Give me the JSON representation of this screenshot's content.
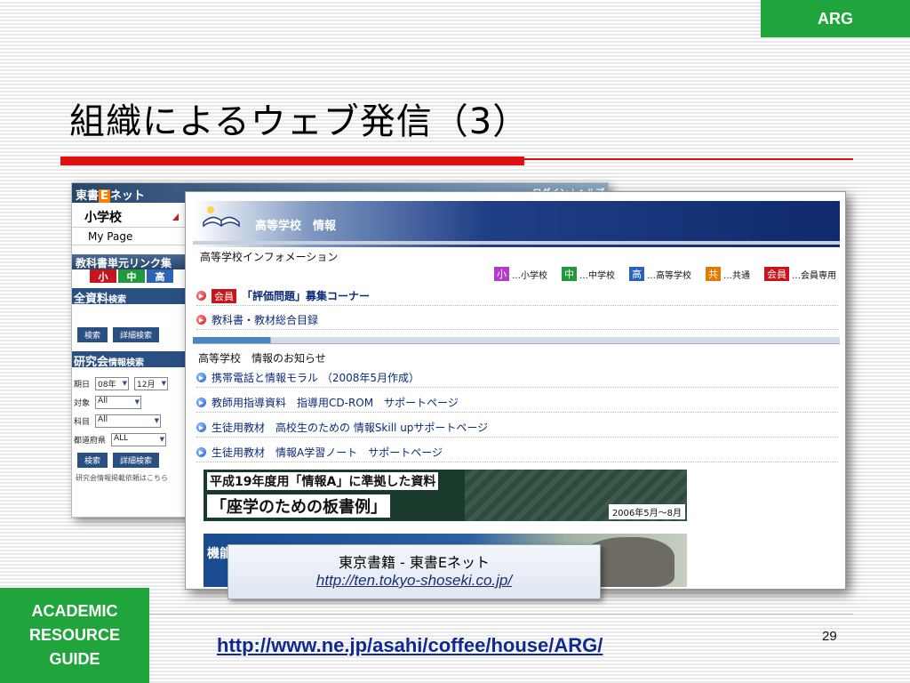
{
  "badge": {
    "label": "ARG"
  },
  "slide": {
    "title": "組織によるウェブ発信（3）",
    "page_number": "29"
  },
  "sidebar_box": {
    "lines": [
      "ACADEMIC",
      "RESOURCE",
      "GUIDE"
    ]
  },
  "footer": {
    "url": "http://www.ne.jp/asahi/coffee/house/ARG/"
  },
  "callout": {
    "name": "東京書籍 - 東書Eネット",
    "url": "http://ten.tokyo-shoseki.co.jp/"
  },
  "back_site": {
    "header_prefix": "東書",
    "header_e": "E",
    "header_suffix": "ネット",
    "login": "ログイン | ヘルプ",
    "level_tab": "小学校",
    "mypage": "My Page",
    "unit_link_bar": "教科書単元リンク集",
    "levels": [
      "小",
      "中",
      "高"
    ],
    "all_materials_title": "全資料",
    "all_materials_suffix": "検索",
    "search_btn": "検索",
    "detail_btn": "詳細検索",
    "seminar_title": "研究会",
    "seminar_suffix": "情報検索",
    "form": [
      {
        "label": "期日",
        "values": [
          "08年",
          "12月"
        ]
      },
      {
        "label": "対象",
        "values": [
          "All"
        ]
      },
      {
        "label": "科目",
        "values": [
          "All"
        ]
      },
      {
        "label": "都道府県",
        "values": [
          "ALL"
        ]
      }
    ],
    "search_btn2": "検索",
    "detail_btn2": "詳細検索",
    "footnote": "研究会情報掲載依頼はこちら"
  },
  "front_site": {
    "header": "高等学校　情報",
    "info_title": "高等学校インフォメーション",
    "legend": [
      {
        "tag": "小",
        "text": "…小学校",
        "color": "#b33dc6"
      },
      {
        "tag": "中",
        "text": "…中学校",
        "color": "#1f9a3a"
      },
      {
        "tag": "高",
        "text": "…高等学校",
        "color": "#2a63b8"
      },
      {
        "tag": "共",
        "text": "…共通",
        "color": "#e07b00"
      },
      {
        "tag": "会員",
        "text": "…会員専用",
        "color": "#c9141b"
      }
    ],
    "info_items": [
      {
        "member_tag": "会員",
        "text": "「評価問題」募集コーナー"
      },
      {
        "text": "教科書・教材総合目録"
      }
    ],
    "news_title": "高等学校　情報のお知らせ",
    "news_items": [
      "携帯電話と情報モラル （2008年5月作成）",
      "教師用指導資料　指導用CD-ROM　サポートページ",
      "生徒用教材　高校生のための 情報Skill upサポートページ",
      "生徒用教材　情報A学習ノート　サポートページ"
    ],
    "banner1": {
      "line1": "平成19年度用「情報A」に準拠した資料",
      "line2": "「座学のための板書例」",
      "date": "2006年5月～8月"
    },
    "banner2": {
      "stub": "機能"
    }
  },
  "colors": {
    "accent_green": "#1fa53b",
    "title_red": "#e01010",
    "link_blue": "#102a8f"
  }
}
